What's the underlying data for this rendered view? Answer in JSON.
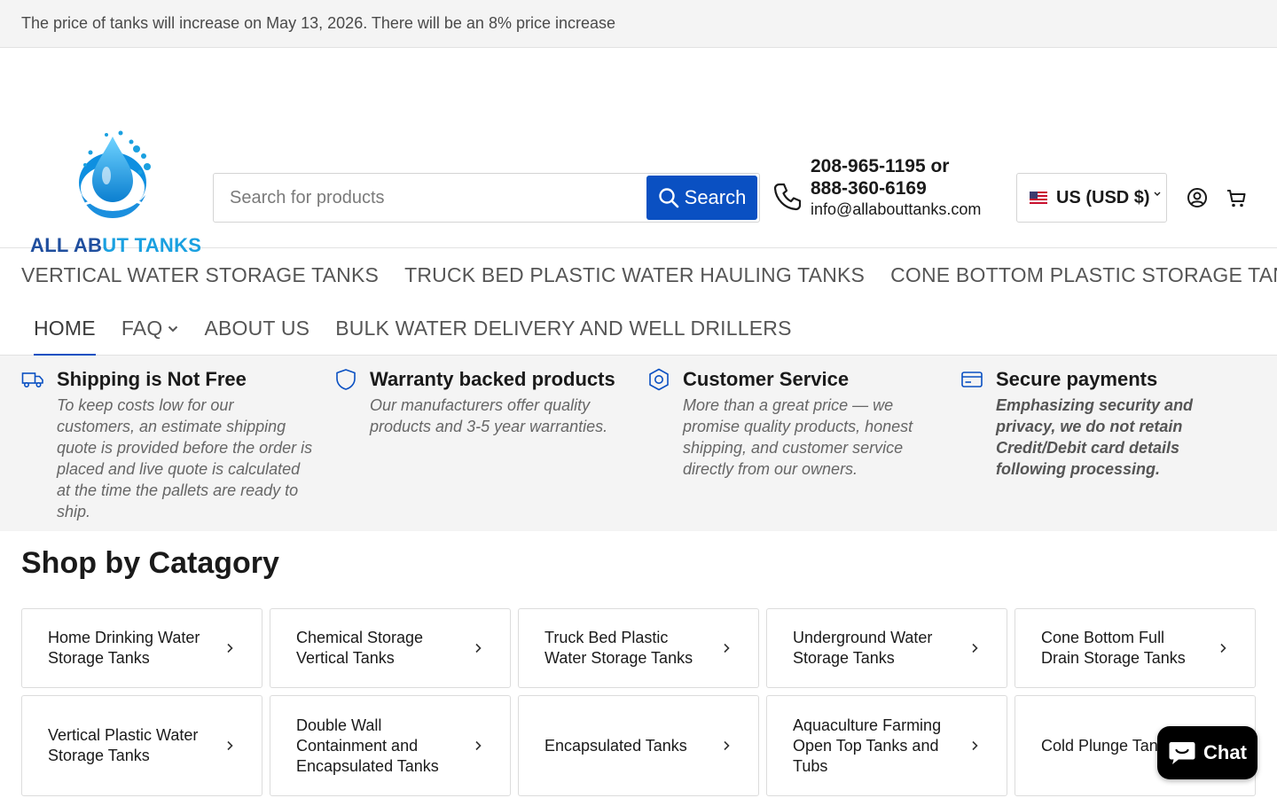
{
  "announcement": {
    "text": "The price of tanks will increase on May 13, 2026. There will be an 8% price increase"
  },
  "header": {
    "logo": {
      "text_part1": "ALL AB",
      "text_part2": "U",
      "text_part3": "T TANKS"
    },
    "search": {
      "placeholder": "Search for products",
      "button_label": "Search"
    },
    "contact": {
      "phones": "208-965-1195 or 888-360-6169",
      "email": "info@allabouttanks.com"
    },
    "currency": {
      "label": "US (USD $)"
    }
  },
  "nav": {
    "row1": [
      {
        "label": "VERTICAL WATER STORAGE TANKS"
      },
      {
        "label": "TRUCK BED PLASTIC WATER HAULING TANKS"
      },
      {
        "label": "CONE BOTTOM PLASTIC STORAGE TANKS"
      }
    ],
    "row2": [
      {
        "label": "HOME",
        "active": true
      },
      {
        "label": "FAQ",
        "dropdown": true
      },
      {
        "label": "ABOUT US"
      },
      {
        "label": "BULK WATER DELIVERY AND WELL DRILLERS"
      }
    ]
  },
  "features": [
    {
      "icon": "truck-icon",
      "title": "Shipping is Not Free",
      "text": "To keep costs low for our customers, an estimate shipping quote is provided before the order is placed and live quote is calculated at the time the pallets are ready to ship."
    },
    {
      "icon": "shield-icon",
      "title": "Warranty backed products",
      "text": "Our manufacturers offer quality products and 3-5 year warranties."
    },
    {
      "icon": "hexagon-badge-icon",
      "title": "Customer Service",
      "text": "More than a great price — we promise quality products, honest shipping, and customer service directly from our owners."
    },
    {
      "icon": "credit-card-icon",
      "title": "Secure payments",
      "text": "Emphasizing security and privacy, we do not retain Credit/Debit card details following processing."
    }
  ],
  "shop": {
    "title": "Shop by Catagory",
    "categories": [
      {
        "label": "Home Drinking Water Storage Tanks"
      },
      {
        "label": "Chemical Storage Vertical Tanks"
      },
      {
        "label": "Truck Bed Plastic Water Storage Tanks"
      },
      {
        "label": "Underground Water Storage Tanks"
      },
      {
        "label": "Cone Bottom Full Drain Storage Tanks"
      },
      {
        "label": "Vertical Plastic Water Storage Tanks"
      },
      {
        "label": "Double Wall Containment and Encapsulated Tanks"
      },
      {
        "label": "Encapsulated Tanks"
      },
      {
        "label": "Aquaculture Farming Open Top Tanks and Tubs"
      },
      {
        "label": "Cold Plunge Tanks"
      }
    ]
  },
  "chat": {
    "label": "Chat"
  },
  "colors": {
    "accent": "#0a50c2",
    "feature_bg": "#f4f4f4",
    "logo_dark": "#1f4e9e",
    "logo_light": "#1aa0e0"
  }
}
